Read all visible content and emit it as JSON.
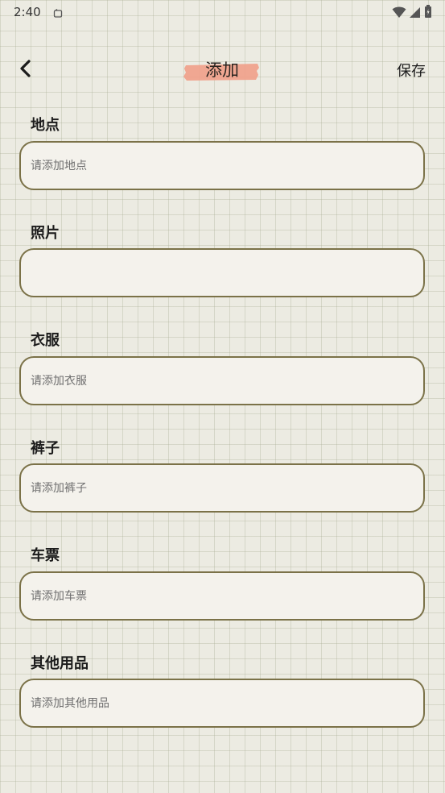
{
  "status_bar": {
    "time": "2:40",
    "icons": [
      "notification-icon",
      "wifi-icon",
      "signal-icon",
      "battery-icon"
    ]
  },
  "header": {
    "title": "添加",
    "save_label": "保存",
    "back_icon": "chevron-left-icon",
    "title_highlight_color": "#f1a08a"
  },
  "fields": {
    "location": {
      "label": "地点",
      "placeholder": "请添加地点",
      "value": ""
    },
    "photo": {
      "label": "照片",
      "placeholder": "",
      "value": ""
    },
    "clothes": {
      "label": "衣服",
      "placeholder": "请添加衣服",
      "value": ""
    },
    "pants": {
      "label": "裤子",
      "placeholder": "请添加裤子",
      "value": ""
    },
    "ticket": {
      "label": "车票",
      "placeholder": "请添加车票",
      "value": ""
    },
    "other": {
      "label": "其他用品",
      "placeholder": "请添加其他用品",
      "value": ""
    }
  },
  "colors": {
    "background": "#ecebe2",
    "field_border": "#7b7248",
    "field_fill": "#f4f2ec"
  }
}
